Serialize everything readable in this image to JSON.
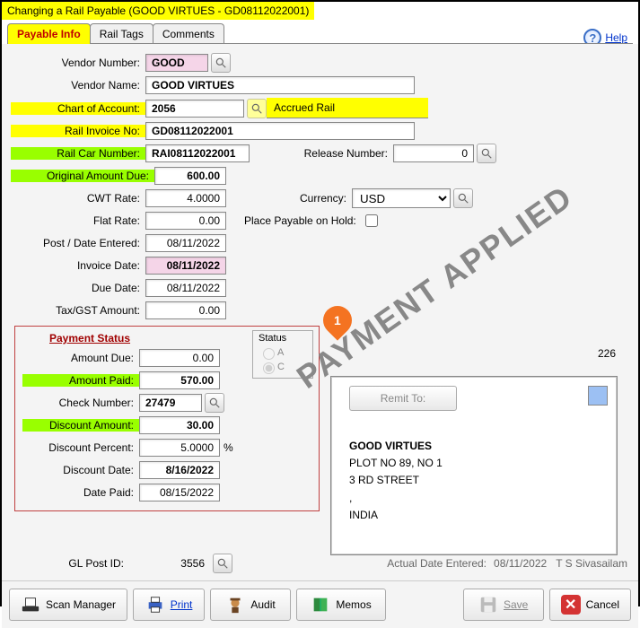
{
  "title": "Changing a Rail Payable  (GOOD VIRTUES - GD08112022001)",
  "tabs": {
    "t0": "Payable Info",
    "t1": "Rail Tags",
    "t2": "Comments"
  },
  "help": "Help",
  "labels": {
    "vendor_number": "Vendor Number:",
    "vendor_name": "Vendor Name:",
    "chart_of_account": "Chart of Account:",
    "rail_invoice_no": "Rail Invoice No:",
    "rail_car_number": "Rail Car Number:",
    "release_number": "Release Number:",
    "original_amount_due": "Original Amount Due:",
    "cwt_rate": "CWT Rate:",
    "flat_rate": "Flat Rate:",
    "post_date_entered": "Post / Date Entered:",
    "invoice_date": "Invoice Date:",
    "due_date": "Due Date:",
    "tax_gst_amount": "Tax/GST Amount:",
    "currency": "Currency:",
    "place_payable_on_hold": "Place Payable on Hold:",
    "gl_post_id": "GL Post ID:",
    "actual_date_entered": "Actual Date Entered:"
  },
  "values": {
    "vendor_number": "GOOD",
    "vendor_name": "GOOD VIRTUES",
    "chart_of_account": "2056",
    "chart_of_account_desc": "Accrued Rail",
    "rail_invoice_no": "GD08112022001",
    "rail_car_number": "RAI08112022001",
    "release_number": "0",
    "original_amount_due": "600.00",
    "cwt_rate": "4.0000",
    "flat_rate": "0.00",
    "post_date_entered": "08/11/2022",
    "invoice_date": "08/11/2022",
    "due_date": "08/11/2022",
    "tax_gst_amount": "0.00",
    "currency": "USD",
    "gl_post_id": "3556",
    "actual_date_entered": "08/11/2022",
    "actual_user": "T S Sivasailam",
    "side_num": "226"
  },
  "payment": {
    "header": "Payment Status",
    "labels": {
      "amount_due": "Amount Due:",
      "amount_paid": "Amount Paid:",
      "check_number": "Check Number:",
      "discount_amount": "Discount Amount:",
      "discount_percent": "Discount Percent:",
      "discount_date": "Discount Date:",
      "date_paid": "Date Paid:"
    },
    "values": {
      "amount_due": "0.00",
      "amount_paid": "570.00",
      "check_number": "27479",
      "discount_amount": "30.00",
      "discount_percent": "5.0000",
      "discount_date": "8/16/2022",
      "date_paid": "08/15/2022"
    },
    "status_box": {
      "title": "Status",
      "optA": "A",
      "optC": "C"
    },
    "percent_suffix": "%"
  },
  "remit": {
    "button": "Remit To:",
    "name": "GOOD VIRTUES",
    "line1": "PLOT NO 89, NO 1",
    "line2": "3 RD STREET",
    "line3": ",",
    "line4": "INDIA"
  },
  "watermark": "PAYMENT APPLIED",
  "marker": "1",
  "buttons": {
    "scan": "Scan Manager",
    "print": "Print",
    "audit": "Audit",
    "memos": "Memos",
    "save": "Save",
    "cancel": "Cancel"
  }
}
